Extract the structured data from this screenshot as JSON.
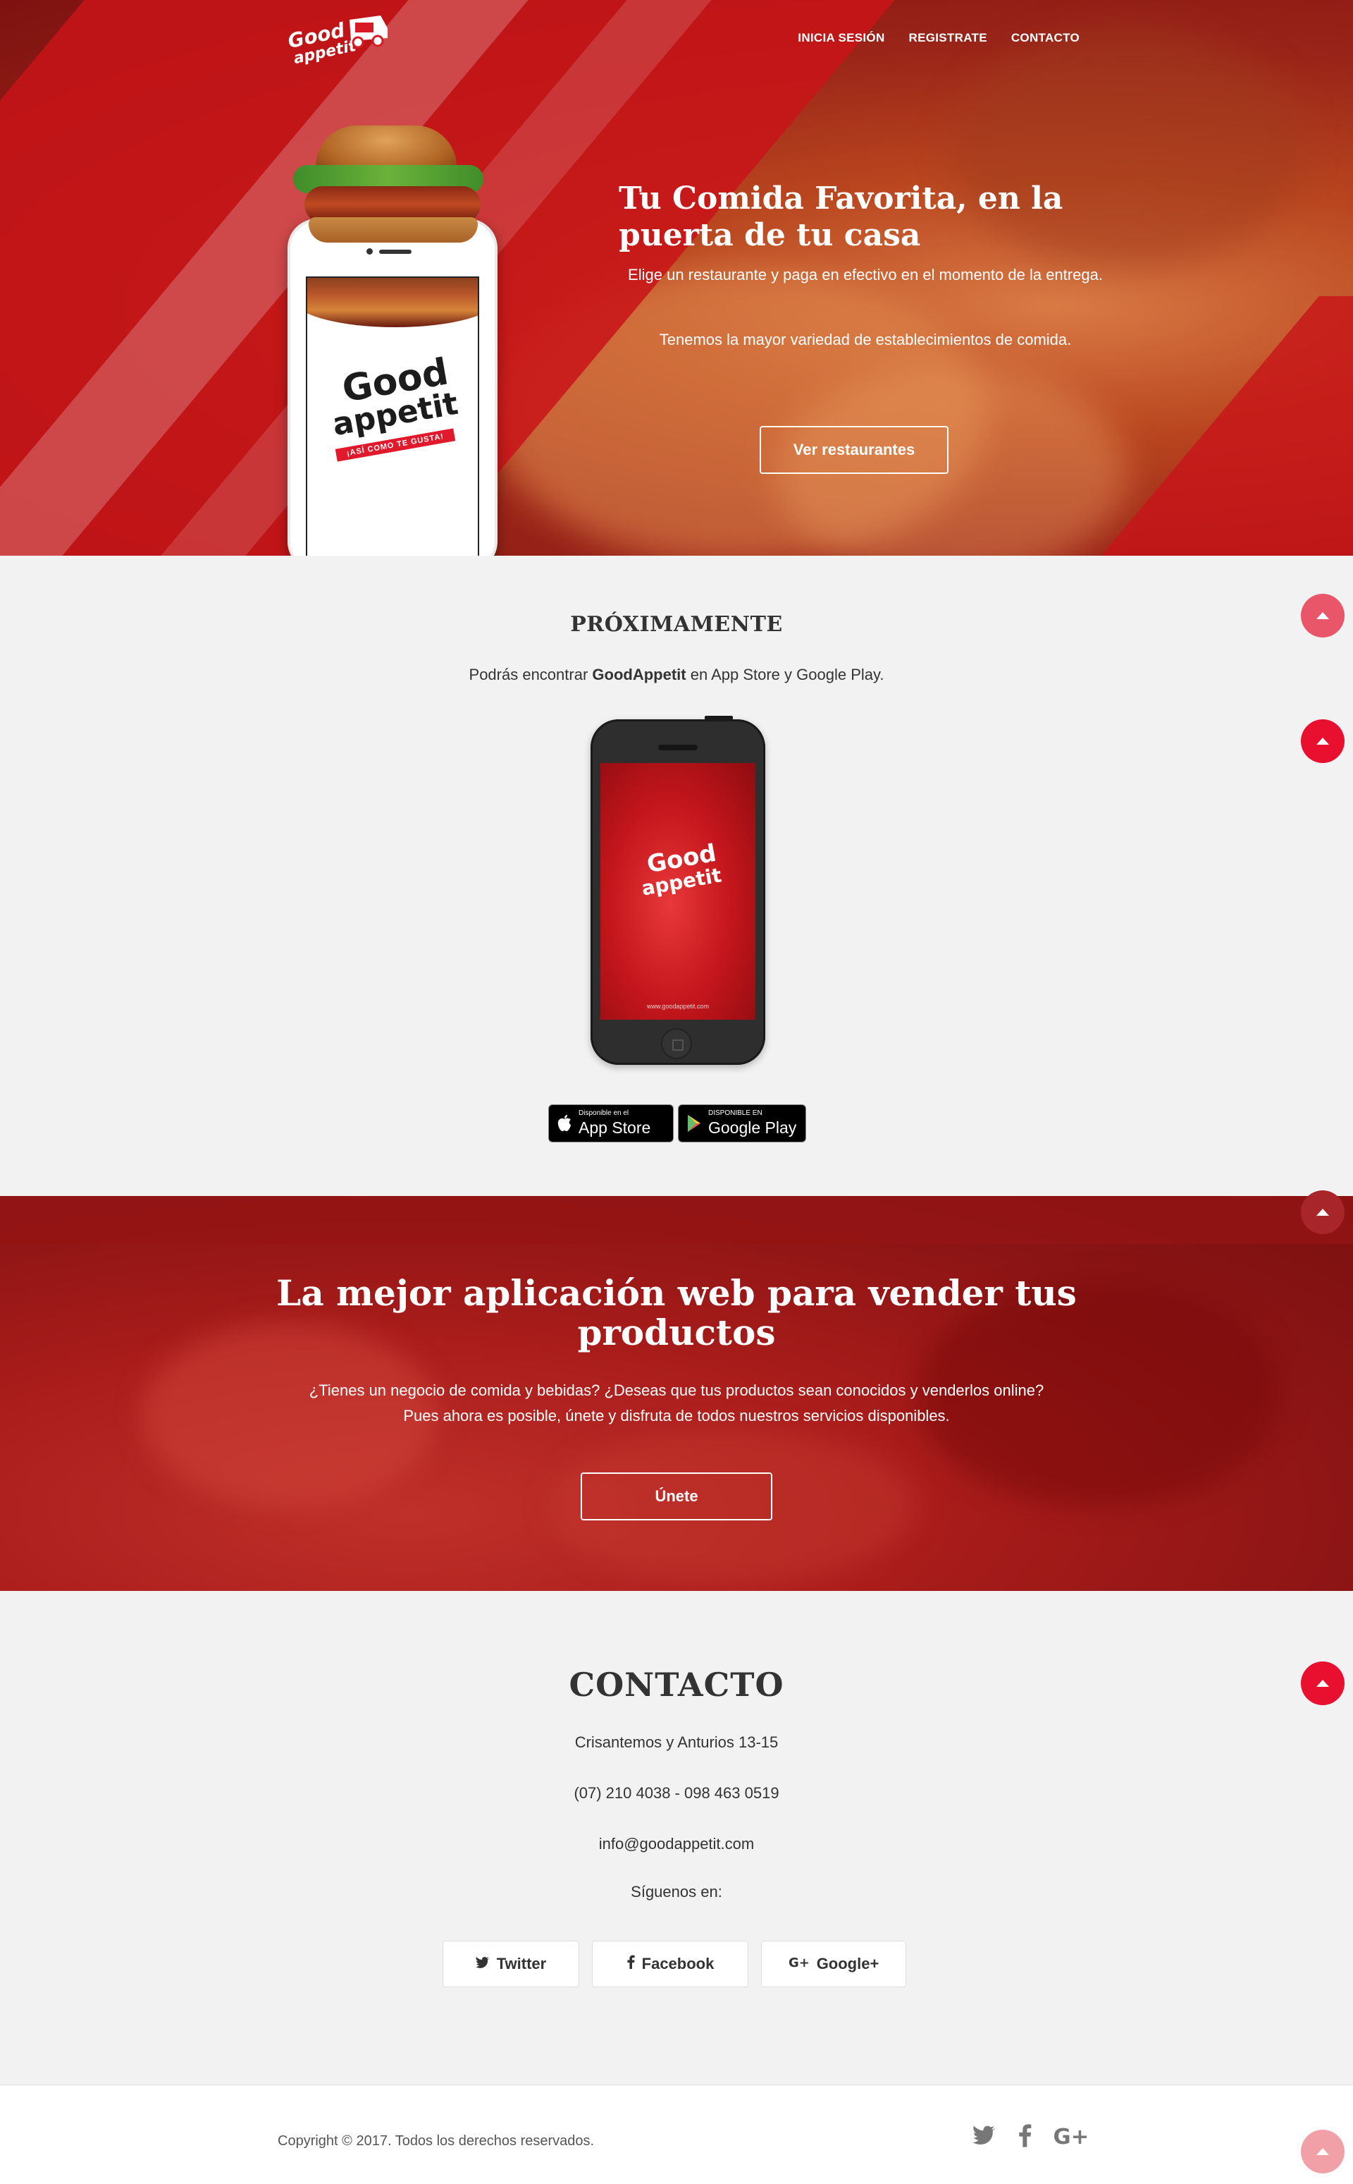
{
  "brand": {
    "logo_line1": "Good",
    "logo_line2": "appetit",
    "accent_color": "#e0192c"
  },
  "nav": {
    "items": [
      "INICIA SESIÓN",
      "REGISTRATE",
      "CONTACTO"
    ]
  },
  "hero": {
    "title": "Tu Comida Favorita, en la puerta de tu casa",
    "paragraph1": "Elige un restaurante y paga en efectivo en el momento de la entrega.",
    "paragraph2": "Tenemos la mayor variedad de establecimientos de comida.",
    "button": "Ver restaurantes",
    "phone_logo_line1": "Good",
    "phone_logo_line2": "appetit",
    "phone_tagline": "¡ASÍ COMO TE GUSTA!"
  },
  "proximamente": {
    "title": "PRÓXIMAMENTE",
    "text_before": "Podrás encontrar ",
    "text_bold": "GoodAppetit",
    "text_after": " en App Store y Google Play.",
    "phone_logo_line1": "Good",
    "phone_logo_line2": "appetit",
    "phone_url": "www.goodappetit.com",
    "app_store": {
      "small": "Disponible en el",
      "big": "App Store",
      "icon": "apple-icon"
    },
    "google_play": {
      "small": "DISPONIBLE EN",
      "big": "Google Play",
      "icon": "play-icon"
    }
  },
  "vender": {
    "title": "La mejor aplicación web para vender tus productos",
    "text": "¿Tienes un negocio de comida y bebidas? ¿Deseas que tus productos sean conocidos y venderlos online? Pues ahora es posible, únete y disfruta de todos nuestros servicios disponibles.",
    "button": "Únete"
  },
  "contacto": {
    "title": "CONTACTO",
    "address": "Crisantemos y Anturios 13-15",
    "phone": "(07) 210 4038 - 098 463 0519",
    "email": "info@goodappetit.com",
    "follow": "Síguenos en:",
    "social": [
      {
        "label": "Twitter",
        "icon": "twitter-icon"
      },
      {
        "label": "Facebook",
        "icon": "facebook-icon"
      },
      {
        "label": "Google+",
        "icon": "google-plus-icon"
      }
    ]
  },
  "footer": {
    "copyright": "Copyright © 2017. Todos los derechos reservados.",
    "icons": [
      "twitter-icon",
      "facebook-icon",
      "google-plus-icon"
    ]
  }
}
